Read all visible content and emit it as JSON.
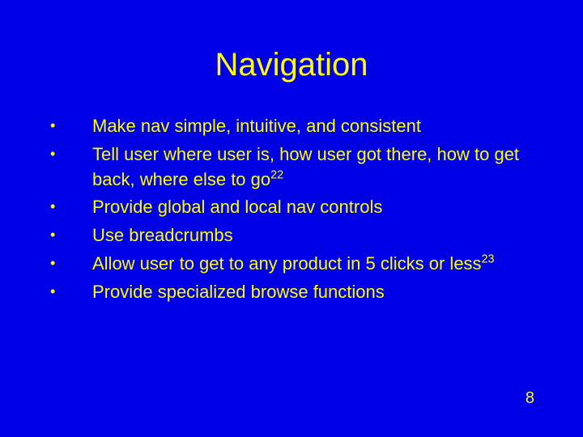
{
  "title": "Navigation",
  "bullets": [
    {
      "text": "Make nav simple, intuitive, and consistent",
      "sup": ""
    },
    {
      "text": "Tell user where user is, how user got there, how to get back, where else to go",
      "sup": "22"
    },
    {
      "text": "Provide global and local nav controls",
      "sup": ""
    },
    {
      "text": "Use breadcrumbs",
      "sup": ""
    },
    {
      "text": "Allow user to get to any product in 5 clicks or less",
      "sup": "23"
    },
    {
      "text": "Provide specialized browse functions",
      "sup": ""
    }
  ],
  "page_number": "8"
}
